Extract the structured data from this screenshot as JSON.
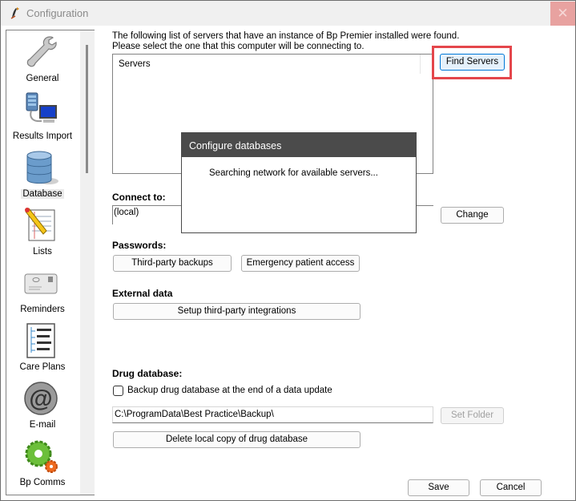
{
  "window": {
    "title": "Configuration",
    "close_glyph": "✕"
  },
  "sidebar": {
    "items": [
      {
        "label": "General",
        "icon": "wrench-icon",
        "selected": false
      },
      {
        "label": "Results Import",
        "icon": "server-computer-icon",
        "selected": false
      },
      {
        "label": "Database",
        "icon": "database-icon",
        "selected": true
      },
      {
        "label": "Lists",
        "icon": "notepad-pencil-icon",
        "selected": false
      },
      {
        "label": "Reminders",
        "icon": "envelope-icon",
        "selected": false
      },
      {
        "label": "Care Plans",
        "icon": "tree-document-icon",
        "selected": false
      },
      {
        "label": "E-mail",
        "icon": "at-sign-icon",
        "selected": false
      },
      {
        "label": "Bp Comms",
        "icon": "gears-icon",
        "selected": false
      }
    ]
  },
  "main": {
    "intro_line1": "The following list of servers that have an instance of Bp Premier installed were found.",
    "intro_line2": "Please select the one that this computer will be connecting to.",
    "servers_column_header": "Servers",
    "find_servers_label": "Find Servers",
    "connect_to_label": "Connect to:",
    "connect_to_value": "(local)",
    "change_label": "Change",
    "passwords_label": "Passwords:",
    "third_party_backups_label": "Third-party backups",
    "emergency_access_label": "Emergency patient access",
    "external_data_label": "External data",
    "setup_integrations_label": "Setup third-party integrations",
    "drug_database_label": "Drug database:",
    "backup_checkbox_label": "Backup drug database at the end of a data update",
    "backup_checkbox_checked": false,
    "backup_folder_value": "C:\\ProgramData\\Best Practice\\Backup\\",
    "set_folder_label": "Set Folder",
    "delete_local_copy_label": "Delete local copy of drug database",
    "save_label": "Save",
    "cancel_label": "Cancel"
  },
  "popup": {
    "title": "Configure databases",
    "message": "Searching network for available servers..."
  },
  "colors": {
    "highlight_border": "#e4464b",
    "popup_title_bg": "#4b4b4b",
    "close_button_bg": "#e8a2a0"
  }
}
